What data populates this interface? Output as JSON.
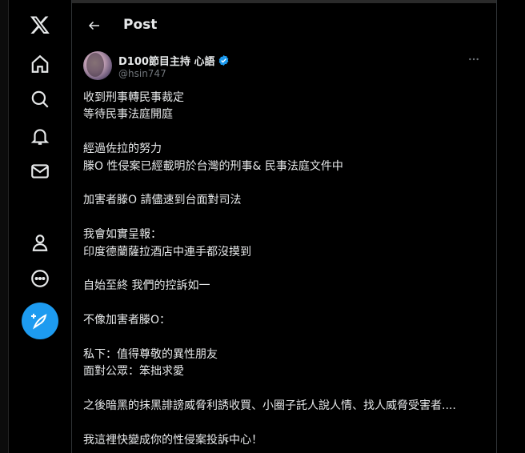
{
  "header": {
    "title": "Post"
  },
  "sidebar": {
    "items": [
      {
        "name": "x-logo-icon"
      },
      {
        "name": "home-icon"
      },
      {
        "name": "search-icon"
      },
      {
        "name": "notifications-icon"
      },
      {
        "name": "messages-icon"
      },
      {
        "name": "profile-icon"
      },
      {
        "name": "more-icon"
      }
    ],
    "post_button_icon": "feather-plus-icon"
  },
  "colors": {
    "accent": "#1d9bf0",
    "background": "#000000",
    "text": "#e7e9ea",
    "muted": "#71767b",
    "border": "#2f3336"
  },
  "post": {
    "author": {
      "display_name": "D100節目主持 心語",
      "handle": "@hsin747",
      "verified": true
    },
    "lines": [
      "收到刑事轉民事裁定",
      "等待民事法庭開庭",
      "",
      "經過佐拉的努力",
      "滕O 性侵案已經載明於台灣的刑事& 民事法庭文件中",
      "",
      "加害者滕O 請儘速到台面對司法",
      "",
      "我會如實呈報：",
      "印度德蘭薩拉酒店中連手都沒摸到",
      "",
      "自始至終 我們的控訴如一",
      "",
      "不像加害者滕O：",
      "",
      "私下：值得尊敬的異性朋友",
      "面對公眾：笨拙求愛",
      "",
      "之後暗黑的抹黑誹謗威脅利誘收買、小圈子託人說人情、找人威脅受害者....",
      "",
      "我這裡快變成你的性侵案投訴中心！"
    ]
  }
}
